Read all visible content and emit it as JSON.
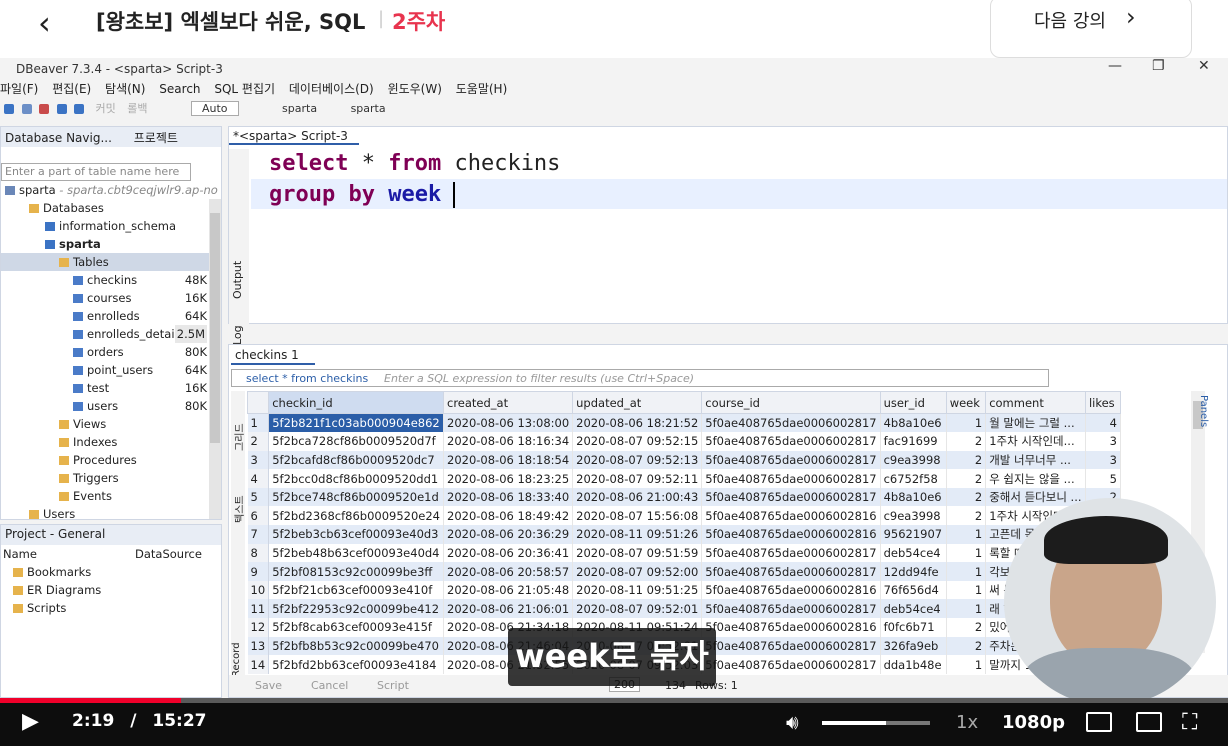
{
  "course": {
    "back_icon": "chevron-left-icon",
    "title": "[왕초보] 엑셀보다 쉬운, SQL",
    "week": "2주차",
    "next_label": "다음 강의",
    "next_icon": "chevron-right-icon"
  },
  "window": {
    "title": "DBeaver 7.3.4 - <sparta> Script-3"
  },
  "menu": [
    "파일(F)",
    "편집(E)",
    "탐색(N)",
    "Search",
    "SQL 편집기",
    "데이터베이스(D)",
    "윈도우(W)",
    "도움말(H)"
  ],
  "toolbar": {
    "commit": "커밋",
    "rollback": "롤백",
    "mode": "Auto",
    "datasource": "sparta",
    "schema": "sparta"
  },
  "navigator": {
    "tab1": "Database Navig...",
    "tab2": "프로젝트",
    "filter_placeholder": "Enter a part of table name here",
    "connection": "sparta",
    "connection_host": " - sparta.cbt9ceqjwlr9.ap-no",
    "databases": "Databases",
    "information_schema": "information_schema",
    "db": "sparta",
    "tables_label": "Tables",
    "tables": [
      {
        "name": "checkins",
        "size": "48K"
      },
      {
        "name": "courses",
        "size": "16K"
      },
      {
        "name": "enrolleds",
        "size": "64K"
      },
      {
        "name": "enrolleds_detail",
        "size": "2.5M"
      },
      {
        "name": "orders",
        "size": "80K"
      },
      {
        "name": "point_users",
        "size": "64K"
      },
      {
        "name": "test",
        "size": "16K"
      },
      {
        "name": "users",
        "size": "80K"
      }
    ],
    "views": "Views",
    "indexes": "Indexes",
    "procedures": "Procedures",
    "triggers": "Triggers",
    "events": "Events",
    "users": "Users"
  },
  "project": {
    "tab": "Project - General",
    "col_name": "Name",
    "col_ds": "DataSource",
    "items": [
      "Bookmarks",
      "ER Diagrams",
      "Scripts"
    ]
  },
  "editor": {
    "tab": "*<sparta> Script-3",
    "line1": {
      "kw1": "select",
      "rest": " * ",
      "kw2": "from",
      "table": " checkins"
    },
    "line2": {
      "kw1": "group by",
      "col": " week"
    },
    "side_output": "Output",
    "side_log": "Log"
  },
  "results": {
    "tab": "checkins 1",
    "filter_query": "select * from checkins",
    "filter_hint": "Enter a SQL expression to filter results (use Ctrl+Space)",
    "columns": [
      "checkin_id",
      "created_at",
      "updated_at",
      "course_id",
      "user_id",
      "week",
      "comment",
      "likes"
    ],
    "rows": [
      [
        "1",
        "5f2b821f1c03ab000904e862",
        "2020-08-06 13:08:00",
        "2020-08-06 18:21:52",
        "5f0ae408765dae0006002817",
        "4b8a10e6",
        "1",
        "월 말에는 그럴 ...",
        "4"
      ],
      [
        "2",
        "5f2bca728cf86b0009520d7f",
        "2020-08-06 18:16:34",
        "2020-08-07 09:52:15",
        "5f0ae408765dae0006002817",
        "fac91699",
        "2",
        "1주차 시작인데...",
        "3"
      ],
      [
        "3",
        "5f2bcafd8cf86b0009520dc7",
        "2020-08-06 18:18:54",
        "2020-08-07 09:52:13",
        "5f0ae408765dae0006002817",
        "c9ea3998",
        "2",
        "개발 너무너무 ...",
        "3"
      ],
      [
        "4",
        "5f2bcc0d8cf86b0009520dd1",
        "2020-08-06 18:23:25",
        "2020-08-07 09:52:11",
        "5f0ae408765dae0006002817",
        "c6752f58",
        "2",
        "우 쉽지는 않을 ...",
        "5"
      ],
      [
        "5",
        "5f2bce748cf86b0009520e1d",
        "2020-08-06 18:33:40",
        "2020-08-06 21:00:43",
        "5f0ae408765dae0006002817",
        "4b8a10e6",
        "2",
        "중해서 듣다보니 ...",
        "2"
      ],
      [
        "6",
        "5f2bd2368cf86b0009520e24",
        "2020-08-06 18:49:42",
        "2020-08-07 15:56:08",
        "5f0ae408765dae0006002816",
        "c9ea3998",
        "2",
        "1주차 시작인데...",
        "2"
      ],
      [
        "7",
        "5f2beb3cb63cef00093e40d3",
        "2020-08-06 20:36:29",
        "2020-08-11 09:51:26",
        "5f0ae408765dae0006002816",
        "95621907",
        "1",
        "고픈데 목요일",
        ""
      ],
      [
        "8",
        "5f2beb48b63cef00093e40d4",
        "2020-08-06 20:36:41",
        "2020-08-07 09:51:59",
        "5f0ae408765dae0006002817",
        "deb54ce4",
        "1",
        "록할 때 마음",
        ""
      ],
      [
        "9",
        "5f2bf08153c92c00099be3ff",
        "2020-08-06 20:58:57",
        "2020-08-07 09:52:00",
        "5f0ae408765dae0006002817",
        "12dd94fe",
        "1",
        "각보다 퇴근",
        ""
      ],
      [
        "10",
        "5f2bf21cb63cef00093e410f",
        "2020-08-06 21:05:48",
        "2020-08-11 09:51:25",
        "5f0ae408765dae0006002816",
        "76f656d4",
        "1",
        "써 목요일",
        ""
      ],
      [
        "11",
        "5f2bf22953c92c00099be412",
        "2020-08-06 21:06:01",
        "2020-08-07 09:52:01",
        "5f0ae408765dae0006002817",
        "deb54ce4",
        "1",
        "래 하나만",
        ""
      ],
      [
        "12",
        "5f2bf8cab63cef00093e415f",
        "2020-08-06 21:34:18",
        "2020-08-11 09:51:24",
        "5f0ae408765dae0006002816",
        "f0fc6b71",
        "2",
        "밌어서 진",
        ""
      ],
      [
        "13",
        "5f2bfb8b53c92c00099be470",
        "2020-08-06 21:46:04",
        "2020-08-07 09:52:01",
        "5f0ae408765dae0006002817",
        "326fa9eb",
        "2",
        "주차는 무시",
        ""
      ],
      [
        "14",
        "5f2bfd2bb63cef00093e4184",
        "2020-08-06 21:52:55",
        "2020-08-07 09:52:03",
        "5f0ae408765dae0006002817",
        "dda1b48e",
        "1",
        "말까지 1주차",
        ""
      ]
    ],
    "save": "Save",
    "cancel": "Cancel",
    "script": "Script",
    "page_size": "200",
    "count": "134",
    "rows_label": "Rows: 1",
    "side_grid": "그리드",
    "side_text": "텍스트",
    "side_record": "Record",
    "side_panels": "Panels"
  },
  "subtitle": "week로 묶자",
  "player": {
    "progress": 0.147,
    "current_time": "2:19",
    "separator": "/",
    "duration": "15:27",
    "speed": "1x",
    "quality": "1080p",
    "volume": 0.59
  }
}
